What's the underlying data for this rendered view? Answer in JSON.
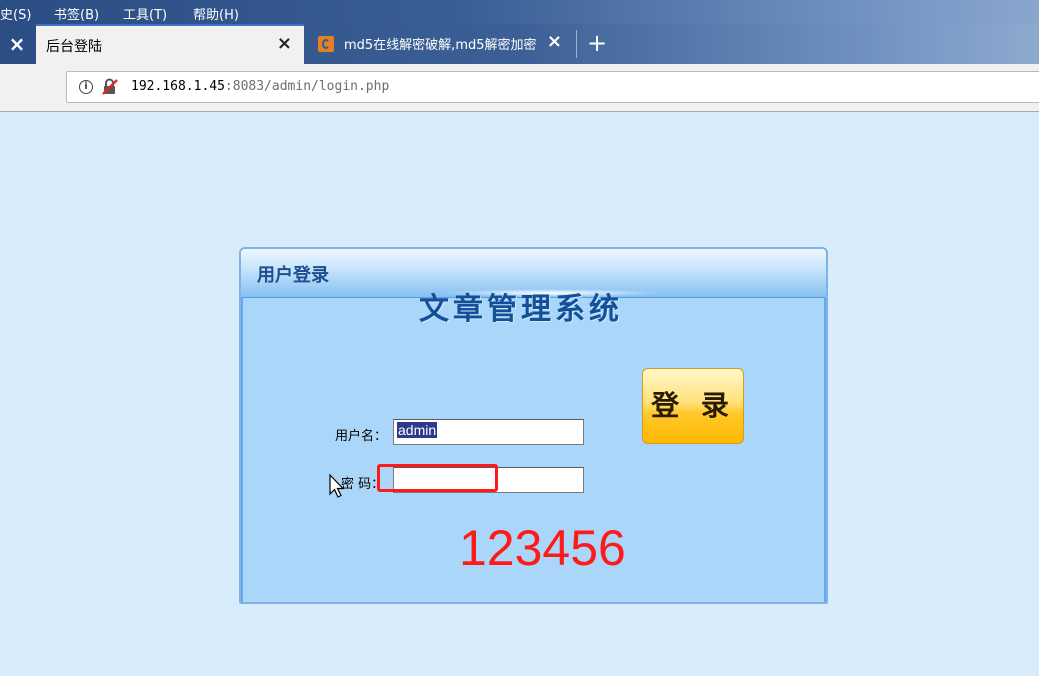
{
  "menubar": {
    "items": [
      "史(S)",
      "书签(B)",
      "工具(T)",
      "帮助(H)"
    ]
  },
  "tabs": [
    {
      "title": "后台登陆",
      "active": true
    },
    {
      "title": "md5在线解密破解,md5解密加密",
      "active": false
    }
  ],
  "icons": {
    "tab_close": "×",
    "new_tab": "+"
  },
  "address": {
    "host": "192.168.1.45",
    "rest": ":8083/admin/login.php"
  },
  "login_panel": {
    "header": "用户登录",
    "system_title": "文章管理系统",
    "username_label": "用户名：",
    "username_value": "admin",
    "password_label": "密  码：",
    "password_value": "",
    "login_button": "登 录"
  },
  "annotation": {
    "text": "123456",
    "color": "#ff1a1a"
  },
  "colors": {
    "page_bg": "#d9ecfb",
    "panel_bg": "#aad6fa",
    "title_blue": "#14509a",
    "button_gold": "#ffc82a"
  }
}
